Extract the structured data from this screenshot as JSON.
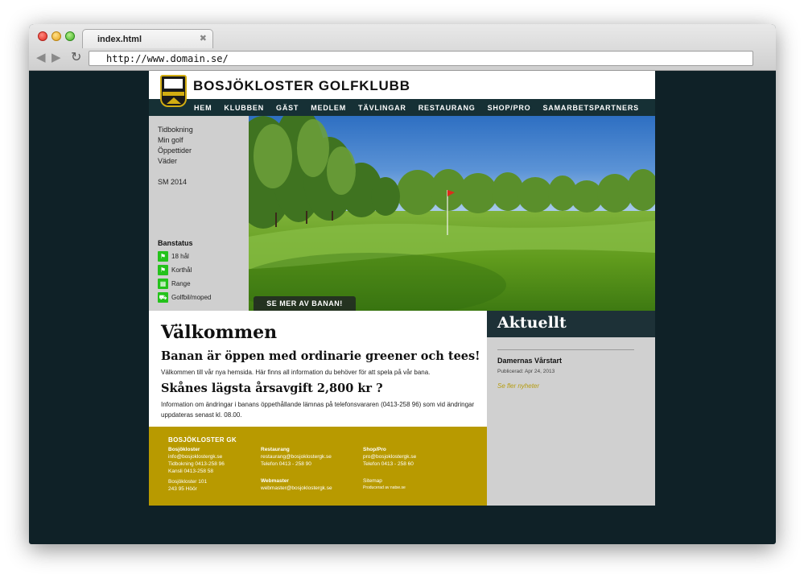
{
  "browser": {
    "tab_title": "index.html",
    "tab_close": "✖",
    "back": "◀",
    "forward": "▶",
    "reload": "↻",
    "url": "http://www.domain.se/"
  },
  "site": {
    "title": "BOSJÖKLOSTER GOLFKLUBB",
    "nav": [
      "HEM",
      "KLUBBEN",
      "GÄST",
      "MEDLEM",
      "TÄVLINGAR",
      "RESTAURANG",
      "SHOP/PRO",
      "SAMARBETSPARTNERS"
    ]
  },
  "sidebar": {
    "links": [
      "Tidbokning",
      "Min golf",
      "Öppettider",
      "Väder"
    ],
    "sm_link": "SM 2014",
    "banstatus_title": "Banstatus",
    "status": [
      {
        "label": "18 hål",
        "icon": "flag-icon",
        "glyph": "⚑"
      },
      {
        "label": "Korthål",
        "icon": "flag-icon",
        "glyph": "⚑"
      },
      {
        "label": "Range",
        "icon": "range-icon",
        "glyph": "▦"
      },
      {
        "label": "Golfbil/moped",
        "icon": "golf-cart-icon",
        "glyph": "⛟"
      }
    ]
  },
  "hero": {
    "button": "SE MER AV BANAN!"
  },
  "main": {
    "heading": "Välkommen",
    "sub1": "Banan är öppen med ordinarie greener och tees!",
    "p1": "Välkommen till vår nya hemsida. Här finns all information du behöver för att spela på vår bana.",
    "sub2": "Skånes lägsta årsavgift 2,800 kr ?",
    "p2": "Information om ändringar i banans öppethållande lämnas på telefonsvararen (0413-258 96) som vid ändringar uppdateras senast kl. 08.00."
  },
  "aktuellt": {
    "heading": "Aktuellt",
    "news_title": "Damernas Vårstart",
    "news_date": "Publicerad: Apr 24, 2013",
    "more": "Se fler nyheter"
  },
  "footer": {
    "title": "BOSJÖKLOSTER GK",
    "col1": {
      "heading": "Bosjökloster",
      "lines": [
        "info@bosjoklostergk.se",
        "Tidbokning 0413-258 96",
        "Kansli 0413-258 58"
      ],
      "address": [
        "Bosjökloster 101",
        "243 95 Höör"
      ]
    },
    "col2": {
      "heading": "Restaurang",
      "lines": [
        "restaurang@bosjoklostergk.se",
        "Telefon 0413 - 258 90"
      ]
    },
    "col3": {
      "heading": "Shop/Pro",
      "lines": [
        "pro@bosjoklostergk.se",
        "Telefon 0413 - 258 60"
      ]
    },
    "col4": {
      "heading": "Webmaster",
      "lines": [
        "webmaster@bosjoklostergk.se"
      ]
    },
    "col5": {
      "heading": "Sitemap",
      "small": "Producerad av natse.se"
    }
  },
  "colors": {
    "accent": "#b89a00",
    "nav_bg": "#163035",
    "status_green": "#24c21b",
    "page_bg": "#0f2127"
  }
}
